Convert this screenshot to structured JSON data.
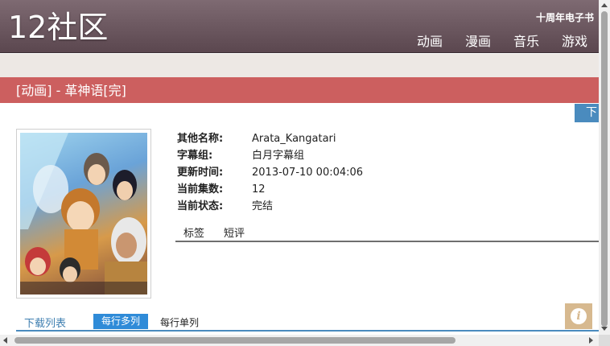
{
  "site": {
    "logo": "12社区",
    "tagline": "十周年电子书",
    "nav": [
      "动画",
      "漫画",
      "音乐",
      "游戏"
    ]
  },
  "page": {
    "title": "[动画] - 革神语[完]",
    "download_tab": "下"
  },
  "details": {
    "rows": [
      {
        "label": "其他名称:",
        "value": "Arata_Kangatari"
      },
      {
        "label": "字幕组:",
        "value": "白月字幕组"
      },
      {
        "label": "更新时间:",
        "value": "2013-07-10 00:04:06"
      },
      {
        "label": "当前集数:",
        "value": "12"
      },
      {
        "label": "当前状态:",
        "value": "完结"
      }
    ],
    "tabs": [
      "标签",
      "短评"
    ]
  },
  "download_list": {
    "title": "下载列表",
    "multi_button": "每行多列",
    "single_button": "每行单列"
  },
  "info_button": "i",
  "colors": {
    "header": "#6b575f",
    "title_bar": "#cc5f5f",
    "accent_blue": "#2f8bd8",
    "info_button": "#d7b98f"
  }
}
